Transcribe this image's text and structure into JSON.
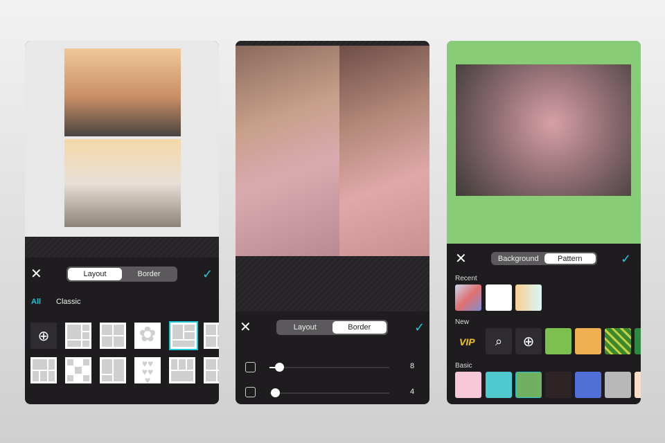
{
  "phone1": {
    "tabs": [
      "Layout",
      "Border"
    ],
    "active_tab": "Layout",
    "filters": [
      "All",
      "Classic"
    ],
    "active_filter": "All",
    "add_icon": "plus-circle-icon",
    "close_icon": "close-icon",
    "confirm_icon": "check-icon",
    "selected_layout_index": 4
  },
  "phone2": {
    "tabs": [
      "Layout",
      "Border"
    ],
    "active_tab": "Border",
    "sliders": [
      {
        "name": "outer-border",
        "value": "8",
        "fraction": 0.08
      },
      {
        "name": "inner-border",
        "value": "4",
        "fraction": 0.04
      }
    ]
  },
  "phone3": {
    "tabs": [
      "Background",
      "Pattern"
    ],
    "active_tab": "Pattern",
    "sections": {
      "recent": "Recent",
      "new": "New",
      "basic": "Basic"
    },
    "vip_label": "VIP",
    "background_color": "#88cc77",
    "accent": "#1fc6d6"
  }
}
